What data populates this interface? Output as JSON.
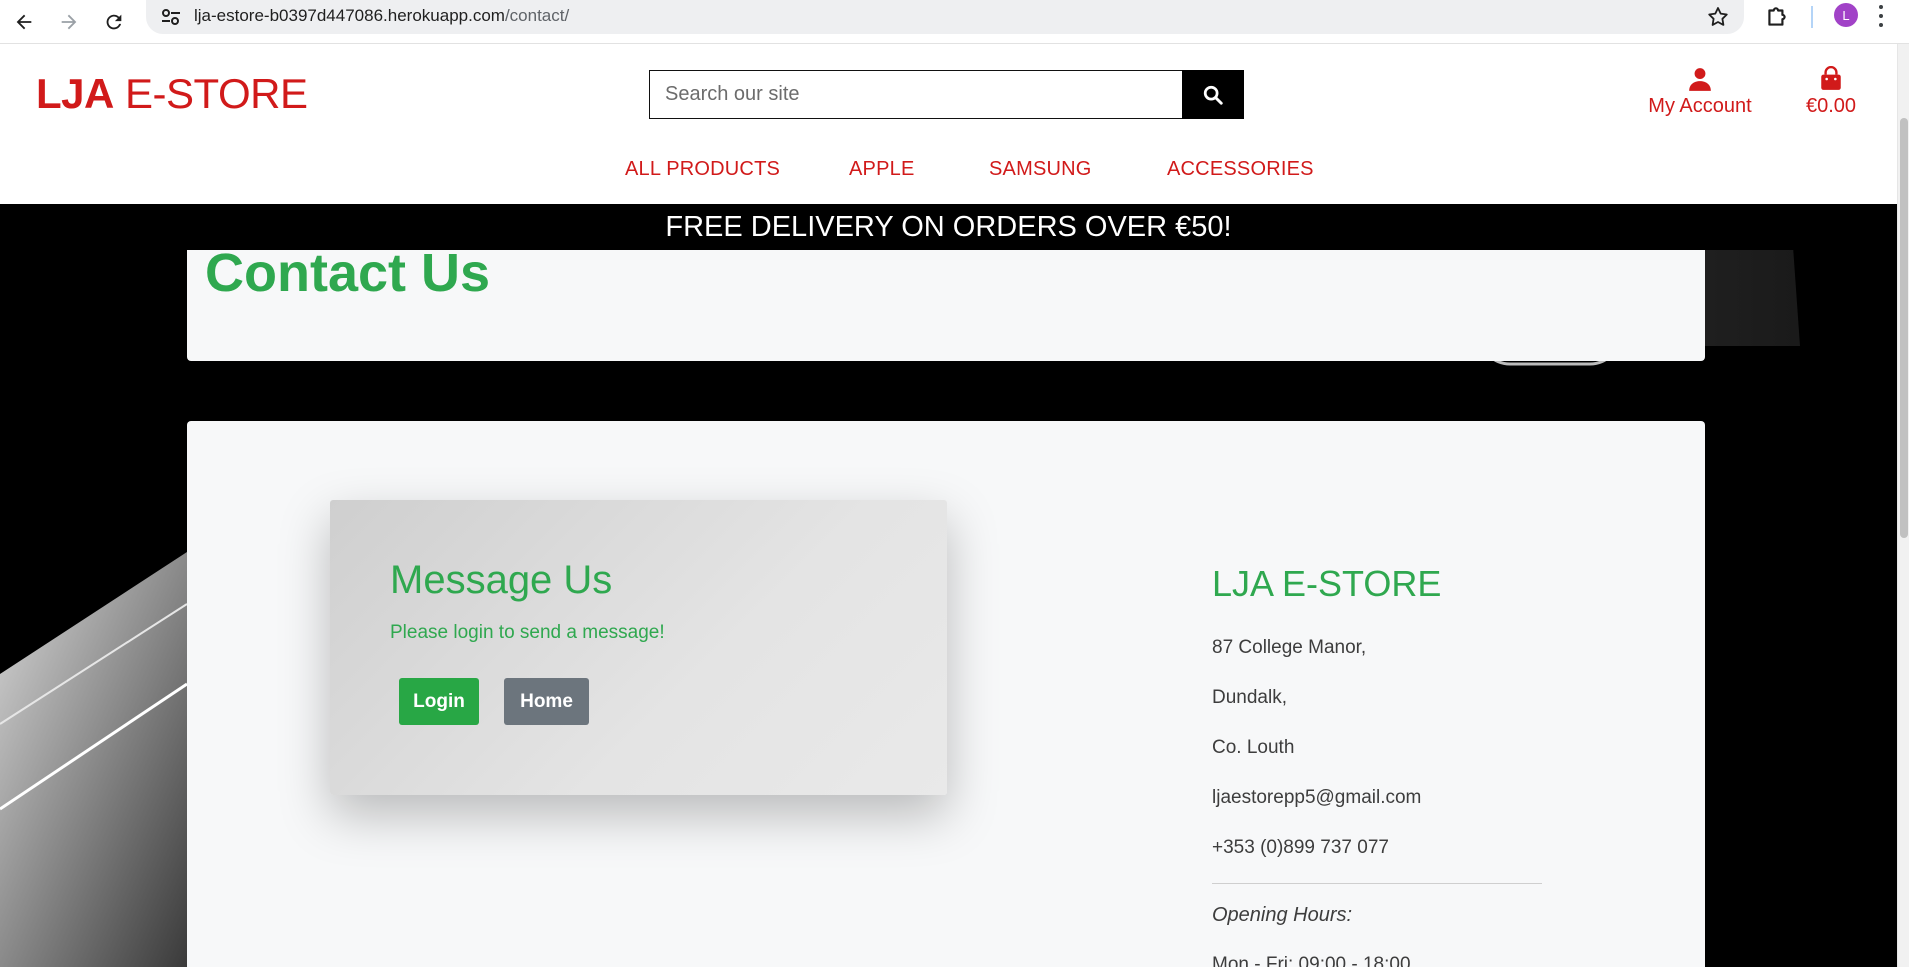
{
  "browser": {
    "url_host": "lja-estore-b0397d447086.herokuapp.com",
    "url_path": "/contact/",
    "avatar_letter": "L"
  },
  "header": {
    "logo_bold": "LJA",
    "logo_rest": " E-STORE",
    "search_placeholder": "Search our site",
    "account_label": "My Account",
    "bag_total": "€0.00"
  },
  "nav": {
    "items": [
      "ALL PRODUCTS",
      "APPLE",
      "SAMSUNG",
      "ACCESSORIES"
    ]
  },
  "banner": {
    "text": "FREE DELIVERY ON ORDERS OVER €50!"
  },
  "page": {
    "title": "Contact Us"
  },
  "message_card": {
    "title": "Message Us",
    "subtitle": "Please login to send a message!",
    "login_label": "Login",
    "home_label": "Home"
  },
  "store": {
    "name": "LJA E-STORE",
    "address": [
      "87 College Manor,",
      "Dundalk,",
      "Co. Louth"
    ],
    "email": "ljaestorepp5@gmail.com",
    "phone": "+353 (0)899 737 077",
    "hours_label": "Opening Hours:",
    "hours_line": "Mon - Fri: 09:00 - 18:00"
  },
  "colors": {
    "brand_red": "#d11a1a",
    "accent_green": "#2fa84f",
    "login_green": "#28a745",
    "home_gray": "#6c757d"
  }
}
